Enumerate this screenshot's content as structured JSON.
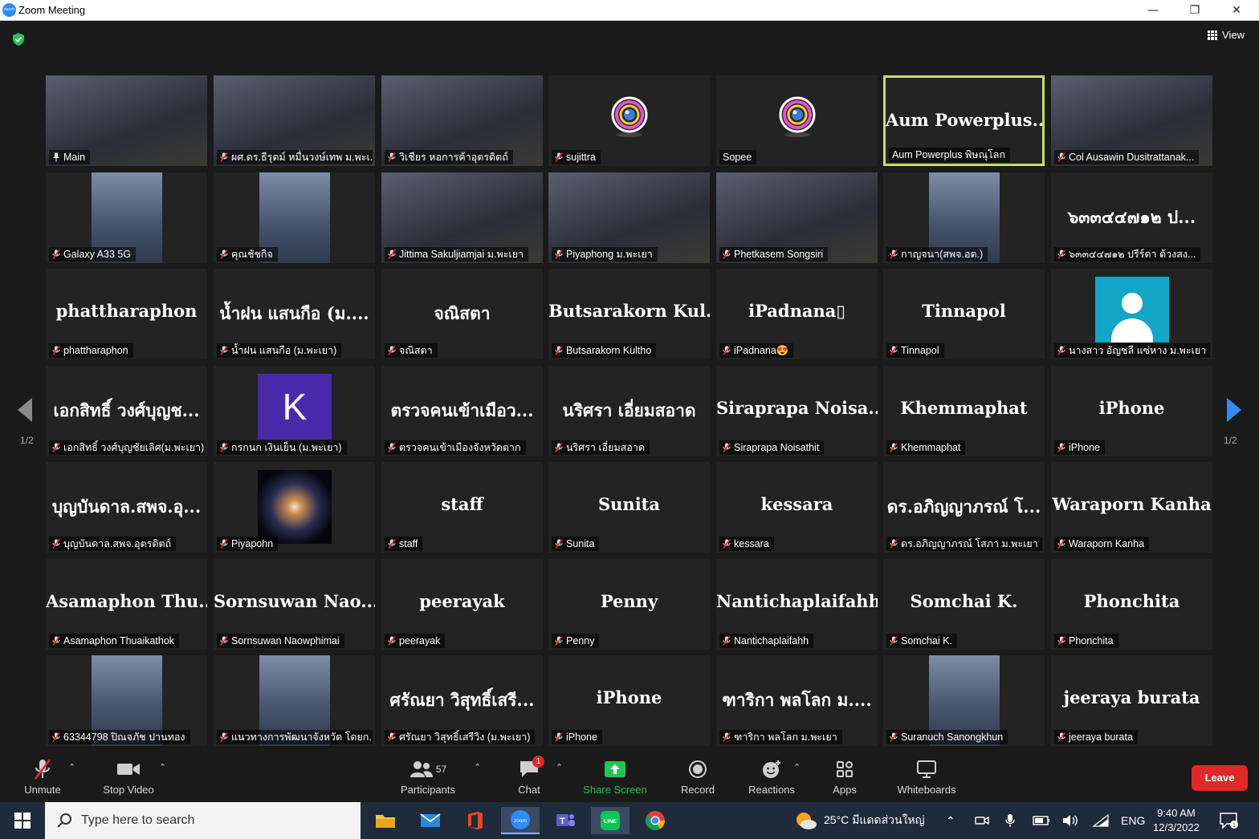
{
  "window": {
    "title": "Zoom Meeting",
    "minimize": "—",
    "restore": "❐",
    "close": "✕"
  },
  "view_label": "View",
  "page_indicator": "1/2",
  "tiles": [
    {
      "big": "",
      "label": "Main",
      "kind": "video",
      "pin": true
    },
    {
      "big": "",
      "label": "ผศ.ดร.ธีรุตม์ หมื่นวงษ์เทพ ม.พะเ...",
      "kind": "video"
    },
    {
      "big": "",
      "label": "วิเชียร หอการค้าอุตรดิตถ์",
      "kind": "video"
    },
    {
      "big": "",
      "label": "sujittra",
      "kind": "camicon"
    },
    {
      "big": "",
      "label": "Sopee",
      "kind": "camicon",
      "nomic": true
    },
    {
      "big": "Aum Powerplus...",
      "label": "Aum Powerplus พิษณุโลก",
      "kind": "name",
      "active": true,
      "nomic": true
    },
    {
      "big": "",
      "label": "Col Ausawin Dusitrattanak...",
      "kind": "video"
    },
    {
      "big": "",
      "label": "Galaxy A33 5G",
      "kind": "portrait"
    },
    {
      "big": "",
      "label": "คุณชัชกิจ",
      "kind": "portrait"
    },
    {
      "big": "",
      "label": "Jittima Sakuljiamjai ม.พะเยา",
      "kind": "video"
    },
    {
      "big": "",
      "label": "Piyaphong ม.พะเยา",
      "kind": "video"
    },
    {
      "big": "",
      "label": "Phetkasem Songsiri",
      "kind": "video"
    },
    {
      "big": "",
      "label": "กาญจนา(สพจ.อต.)",
      "kind": "portrait"
    },
    {
      "big": "๖๓๓๔๔๗๑๒ ป...",
      "label": "๖๓๓๔๔๗๑๒ ปรีร์ดา ต้วงสง...",
      "kind": "name"
    },
    {
      "big": "phattharaphon",
      "label": "phattharaphon",
      "kind": "name"
    },
    {
      "big": "น้ำฝน แสนกือ (ม....",
      "label": "น้ำฝน แสนกือ (ม.พะเยา)",
      "kind": "name"
    },
    {
      "big": "จณิสตา",
      "label": "จณิสตา",
      "kind": "name"
    },
    {
      "big": "Butsarakorn Kul...",
      "label": "Butsarakorn Kultho",
      "kind": "name"
    },
    {
      "big": "iPadnana▯",
      "label": "iPadnana😍",
      "kind": "name"
    },
    {
      "big": "Tinnapol",
      "label": "Tinnapol",
      "kind": "name"
    },
    {
      "big": "",
      "label": "นางสาว อัญชลี แซ่หาง ม.พะเยา",
      "kind": "teal"
    },
    {
      "big": "เอกสิทธิ์ วงศ์บุญช...",
      "label": "เอกสิทธิ์ วงศ์บุญชัยเลิศ(ม.พะเยา)",
      "kind": "name"
    },
    {
      "big": "K",
      "label": "กรกนก เงินเย็น (ม.พะเยา)",
      "kind": "k"
    },
    {
      "big": "ตรวจคนเข้าเมือว...",
      "label": "ตรวจคนเข้าเมืองจังหวัดตาก",
      "kind": "name"
    },
    {
      "big": "นริศรา เอี่ยมสอาด",
      "label": "นริศรา เอี่ยมสอาด",
      "kind": "name"
    },
    {
      "big": "Siraprapa Noisa...",
      "label": "Siraprapa Noisathit",
      "kind": "name"
    },
    {
      "big": "Khemmaphat",
      "label": "Khemmaphat",
      "kind": "name"
    },
    {
      "big": "iPhone",
      "label": "iPhone",
      "kind": "name"
    },
    {
      "big": "บุญบันดาล.สพจ.อุ...",
      "label": "บุญบันดาล.สพจ.อุตรดิตถ์",
      "kind": "name"
    },
    {
      "big": "",
      "label": "Piyapohn",
      "kind": "galaxy"
    },
    {
      "big": "staff",
      "label": "staff",
      "kind": "name"
    },
    {
      "big": "Sunita",
      "label": "Sunita",
      "kind": "name"
    },
    {
      "big": "kessara",
      "label": "kessara",
      "kind": "name"
    },
    {
      "big": "ดร.อภิญญาภรณ์ โ...",
      "label": "ดร.อภิญญาภรณ์ โสภา ม.พะเยา",
      "kind": "name"
    },
    {
      "big": "Waraporn Kanha",
      "label": "Waraporn Kanha",
      "kind": "name"
    },
    {
      "big": "Asamaphon Thu...",
      "label": "Asamaphon Thuaikathok",
      "kind": "name"
    },
    {
      "big": "Sornsuwan Nao...",
      "label": "Sornsuwan Naowphimai",
      "kind": "name"
    },
    {
      "big": "peerayak",
      "label": "peerayak",
      "kind": "name"
    },
    {
      "big": "Penny",
      "label": "Penny",
      "kind": "name"
    },
    {
      "big": "Nantichaplaifahh",
      "label": "Nantichaplaifahh",
      "kind": "name"
    },
    {
      "big": "Somchai K.",
      "label": "Somchai K.",
      "kind": "name"
    },
    {
      "big": "Phonchita",
      "label": "Phonchita",
      "kind": "name"
    },
    {
      "big": "",
      "label": "63344798 ปิณจภัช ปานทอง",
      "kind": "portrait"
    },
    {
      "big": "",
      "label": "แนวทางการพัฒนาจังหวัด โดยก...",
      "kind": "portrait"
    },
    {
      "big": "ศรัณยา วิสุทธิ์เสรี...",
      "label": "ศรัณยา วิสุทธิ์เสรีวิง (ม.พะเยา)",
      "kind": "name"
    },
    {
      "big": "iPhone",
      "label": "iPhone",
      "kind": "name"
    },
    {
      "big": "ฑาริกา พลโลก ม....",
      "label": "ฑาริกา พลโลก ม.พะเยา",
      "kind": "name"
    },
    {
      "big": "",
      "label": "Suranuch Sanongkhun",
      "kind": "portrait"
    },
    {
      "big": "jeeraya burata",
      "label": "jeeraya burata",
      "kind": "name"
    }
  ],
  "toolbar": {
    "unmute": "Unmute",
    "stop_video": "Stop Video",
    "participants": "Participants",
    "participants_count": "57",
    "chat": "Chat",
    "chat_badge": "1",
    "share_screen": "Share Screen",
    "record": "Record",
    "reactions": "Reactions",
    "apps": "Apps",
    "whiteboards": "Whiteboards",
    "leave": "Leave"
  },
  "taskbar": {
    "search_placeholder": "Type here to search",
    "weather": "25°C มีแดดส่วนใหญ่",
    "language": "ENG",
    "time": "9:40 AM",
    "date": "12/3/2022"
  },
  "colors": {
    "active_border": "#c6e05f",
    "leave": "#e02828",
    "share_green": "#23c552",
    "accent": "#2d8cff"
  }
}
